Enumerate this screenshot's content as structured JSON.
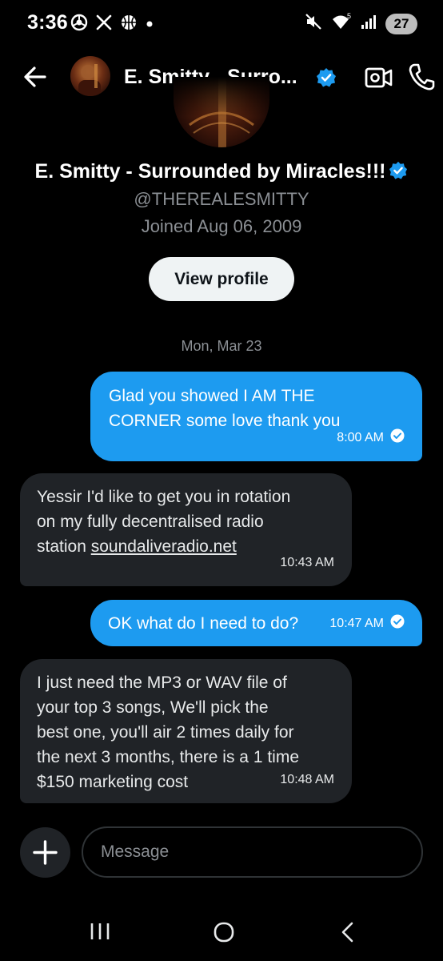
{
  "status_bar": {
    "time": "3:36",
    "battery": "27",
    "icons": [
      "chrome-icon",
      "x-icon",
      "basketball-icon",
      "dot-icon",
      "mute-icon",
      "wifi-icon",
      "signal-icon",
      "battery-icon"
    ],
    "wifi_badge": "5"
  },
  "header": {
    "name": "E. Smitty - Surro...",
    "icons": [
      "back-arrow-icon",
      "verified-badge-icon",
      "video-call-icon",
      "phone-call-icon"
    ]
  },
  "profile": {
    "name": "E. Smitty - Surrounded by Miracles!!!",
    "handle": "@THEREALESMITTY",
    "joined": "Joined Aug 06, 2009",
    "view_profile_label": "View profile"
  },
  "date_separator": "Mon, Mar 23",
  "messages": [
    {
      "direction": "outgoing",
      "lines": [
        "Glad you showed I AM THE",
        "CORNER some love thank you"
      ],
      "time": "8:00 AM",
      "read": true
    },
    {
      "direction": "incoming",
      "lines": [
        "Yessir I'd like to get you in rotation",
        "on my fully decentralised radio"
      ],
      "line3_prefix": "station ",
      "link": "soundaliveradio.net",
      "time": "10:43 AM"
    },
    {
      "direction": "outgoing",
      "text": "OK what do I need to do?",
      "time": "10:47 AM",
      "read": true
    },
    {
      "direction": "incoming",
      "lines": [
        "I just need the MP3 or WAV file of",
        "your top 3 songs, We'll pick the",
        "best one, you'll air 2 times daily for",
        "the next 3 months, there is a 1 time",
        "$150 marketing cost"
      ],
      "time": "10:48 AM"
    }
  ],
  "composer": {
    "placeholder": "Message",
    "value": ""
  },
  "colors": {
    "background": "#000000",
    "accent": "#1d9bf0",
    "incoming_bubble": "#202327",
    "muted_text": "#8b8f94"
  }
}
